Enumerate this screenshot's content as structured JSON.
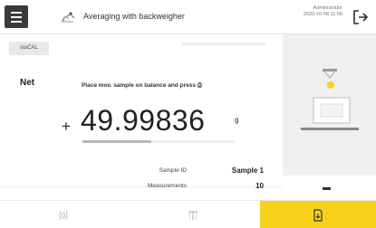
{
  "header": {
    "app_title": "Averaging with backweigher",
    "user": "Administrator",
    "datetime": "2020-10-08  11:00"
  },
  "badge": {
    "isocal": "isoCAL"
  },
  "main": {
    "mode_label": "Net",
    "instruction": "Place mov. sample on balance and press ⎙",
    "sign": "+",
    "weight_value": "49.99836",
    "unit": "g",
    "stability_progress": 0.45
  },
  "details": [
    {
      "key": "Sample ID",
      "value": "Sample 1"
    },
    {
      "key": "Measurements",
      "value": "10"
    }
  ],
  "colors": {
    "accent": "#f6d21a",
    "header_button": "#3a3a3a",
    "panel_bg": "#f0f0f0"
  },
  "icons": {
    "menu": "hamburger-icon",
    "app": "averaging-app-icon",
    "logout": "logout-icon",
    "zero": "zero-icon",
    "tare": "tare-icon",
    "action": "document-arrow-icon"
  }
}
